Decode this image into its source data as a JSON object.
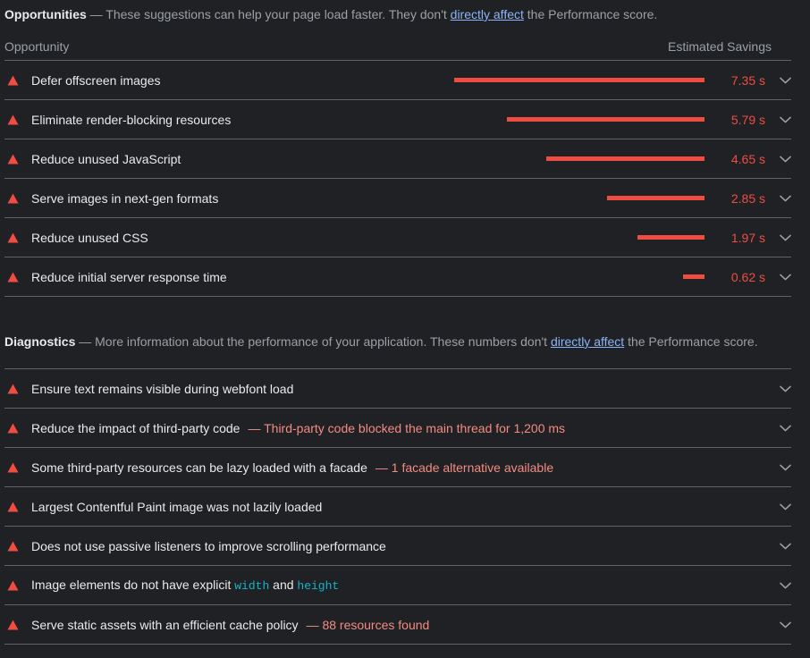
{
  "opportunities": {
    "section_title": "Opportunities",
    "desc_before_link": " — These suggestions can help your page load faster. They don't ",
    "link_text": "directly affect",
    "desc_after_link": " the Performance score.",
    "col_opportunity": "Opportunity",
    "col_savings": "Estimated Savings",
    "max_value": 7.35,
    "rows": [
      {
        "icon": "warning-triangle-icon",
        "title": "Defer offscreen images",
        "savings": "7.35 s",
        "value": 7.35
      },
      {
        "icon": "warning-triangle-icon",
        "title": "Eliminate render-blocking resources",
        "savings": "5.79 s",
        "value": 5.79
      },
      {
        "icon": "warning-triangle-icon",
        "title": "Reduce unused JavaScript",
        "savings": "4.65 s",
        "value": 4.65
      },
      {
        "icon": "warning-triangle-icon",
        "title": "Serve images in next-gen formats",
        "savings": "2.85 s",
        "value": 2.85
      },
      {
        "icon": "warning-triangle-icon",
        "title": "Reduce unused CSS",
        "savings": "1.97 s",
        "value": 1.97
      },
      {
        "icon": "warning-triangle-icon",
        "title": "Reduce initial server response time",
        "savings": "0.62 s",
        "value": 0.62
      }
    ]
  },
  "diagnostics": {
    "section_title": "Diagnostics",
    "desc_before_link": " — More information about the performance of your application. These numbers don't ",
    "link_text": "directly affect",
    "desc_after_link": " the Performance score.",
    "rows": [
      {
        "icon": "warning-triangle-icon",
        "title": "Ensure text remains visible during webfont load",
        "subtitle": ""
      },
      {
        "icon": "warning-triangle-icon",
        "title": "Reduce the impact of third-party code",
        "subtitle": "— Third-party code blocked the main thread for 1,200 ms"
      },
      {
        "icon": "warning-triangle-icon",
        "title": "Some third-party resources can be lazy loaded with a facade",
        "subtitle": "— 1 facade alternative available"
      },
      {
        "icon": "warning-triangle-icon",
        "title": "Largest Contentful Paint image was not lazily loaded",
        "subtitle": ""
      },
      {
        "icon": "warning-triangle-icon",
        "title": "Does not use passive listeners to improve scrolling performance",
        "subtitle": ""
      },
      {
        "icon": "warning-triangle-icon",
        "title": "Image elements do not have explicit ",
        "title_code_1": "width",
        "title_mid": " and ",
        "title_code_2": "height",
        "subtitle": ""
      },
      {
        "icon": "warning-triangle-icon",
        "title": "Serve static assets with an efficient cache policy",
        "subtitle": "— 88 resources found"
      }
    ]
  },
  "colors": {
    "background": "#202124",
    "text_primary": "#e8eaed",
    "text_secondary": "#9aa0a6",
    "link": "#8ab4f8",
    "fail_red": "#f14c42",
    "subtitle_red": "#f28b82",
    "code_cyan": "#12b5cb",
    "divider": "#5f6368"
  },
  "icons": {
    "expand_chevron": "chevron-down-icon"
  }
}
